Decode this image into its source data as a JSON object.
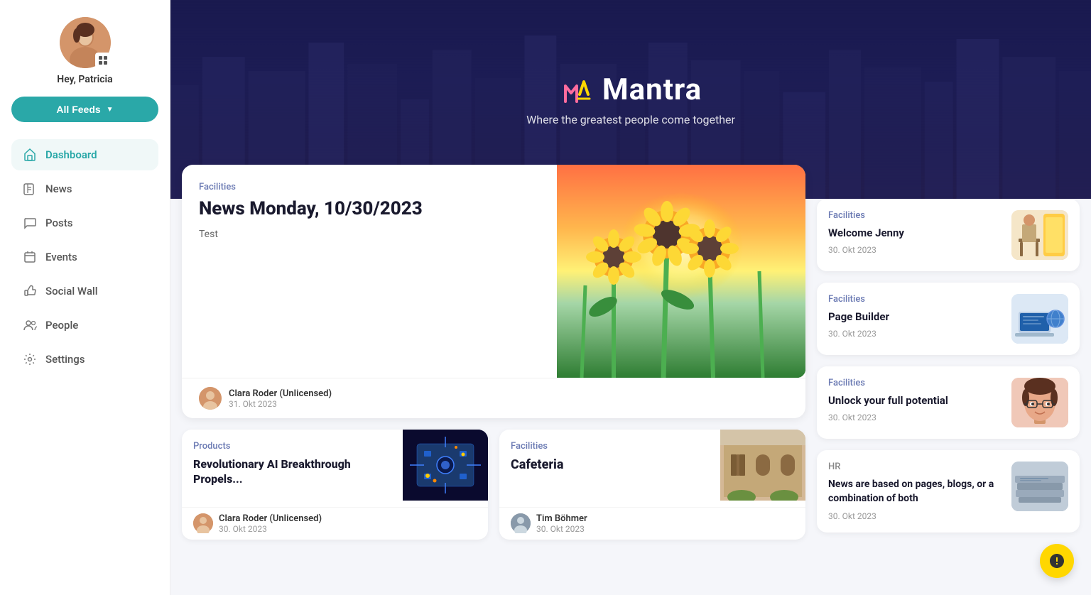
{
  "sidebar": {
    "greeting": "Hey, Patricia",
    "feeds_button": "All Feeds",
    "nav_items": [
      {
        "id": "dashboard",
        "label": "Dashboard",
        "active": true
      },
      {
        "id": "news",
        "label": "News",
        "active": false
      },
      {
        "id": "posts",
        "label": "Posts",
        "active": false
      },
      {
        "id": "events",
        "label": "Events",
        "active": false
      },
      {
        "id": "social-wall",
        "label": "Social Wall",
        "active": false
      },
      {
        "id": "people",
        "label": "People",
        "active": false
      },
      {
        "id": "settings",
        "label": "Settings",
        "active": false
      }
    ]
  },
  "hero": {
    "logo_text": "Mantra",
    "subtitle": "Where the greatest people come together"
  },
  "featured_card": {
    "category": "Facilities",
    "title": "News Monday, 10/30/2023",
    "desc": "Test",
    "author_name": "Clara Roder (Unlicensed)",
    "author_date": "31. Okt 2023"
  },
  "small_cards": [
    {
      "category": "Products",
      "title": "Revolutionary AI Breakthrough Propels...",
      "author_name": "Clara Roder (Unlicensed)",
      "author_date": "30. Okt 2023",
      "img_type": "ai"
    },
    {
      "category": "Facilities",
      "title": "Cafeteria",
      "author_name": "Tim Böhmer",
      "author_date": "30. Okt 2023",
      "img_type": "cafeteria"
    }
  ],
  "side_cards": [
    {
      "category": "Facilities",
      "title": "Welcome Jenny",
      "date": "30. Okt 2023",
      "img_type": "welcome"
    },
    {
      "category": "Facilities",
      "title": "Page Builder",
      "date": "30. Okt 2023",
      "img_type": "pagebuilder"
    },
    {
      "category": "Facilities",
      "title": "Unlock your full potential",
      "date": "30. Okt 2023",
      "img_type": "potential"
    },
    {
      "category": "HR",
      "title": "News are based on pages, blogs, or a combination of both",
      "date": "30. Okt 2023",
      "img_type": "news"
    }
  ],
  "colors": {
    "teal": "#2aa8a8",
    "nav_active": "#2aa8a8",
    "category": "#6b7ab3",
    "hr_category": "#888"
  }
}
